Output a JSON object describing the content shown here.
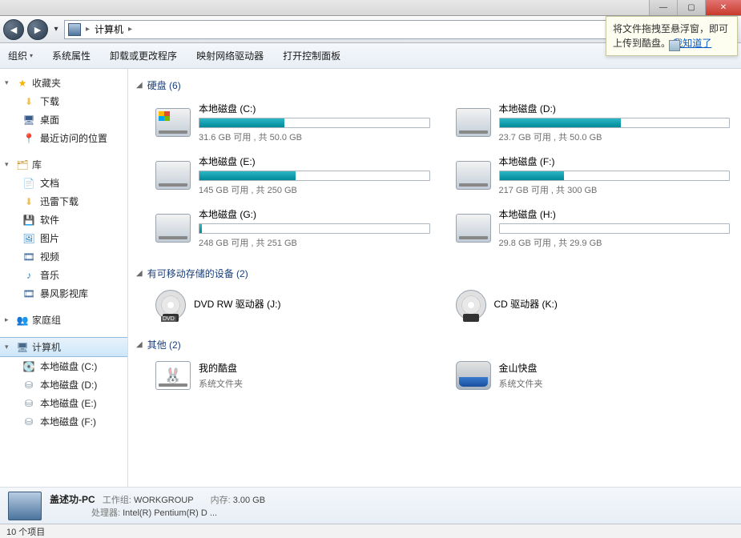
{
  "titlebar": {
    "min": "—",
    "max": "▢",
    "close": "✕"
  },
  "nav": {
    "back": "◄",
    "forward": "►",
    "dd": "▾",
    "path_label": "计算机",
    "arrow": "▸",
    "refresh": "↻",
    "addr_dd": "▾"
  },
  "toolbar": {
    "organize": "组织",
    "dd": "▾",
    "sysprops": "系统属性",
    "uninstall": "卸载或更改程序",
    "mapdrive": "映射网络驱动器",
    "controlpanel": "打开控制面板"
  },
  "sidebar": {
    "fav": {
      "label": "收藏夹",
      "items": [
        {
          "label": "下载"
        },
        {
          "label": "桌面"
        },
        {
          "label": "最近访问的位置"
        }
      ]
    },
    "lib": {
      "label": "库",
      "items": [
        {
          "label": "文档"
        },
        {
          "label": "迅雷下载"
        },
        {
          "label": "软件"
        },
        {
          "label": "图片"
        },
        {
          "label": "视频"
        },
        {
          "label": "音乐"
        },
        {
          "label": "暴风影视库"
        }
      ]
    },
    "homegroup": {
      "label": "家庭组"
    },
    "computer": {
      "label": "计算机",
      "items": [
        {
          "label": "本地磁盘 (C:)"
        },
        {
          "label": "本地磁盘 (D:)"
        },
        {
          "label": "本地磁盘 (E:)"
        },
        {
          "label": "本地磁盘 (F:)"
        }
      ]
    }
  },
  "sections": {
    "hdd": {
      "title": "硬盘 (6)"
    },
    "removable": {
      "title": "有可移动存储的设备 (2)"
    },
    "other": {
      "title": "其他 (2)"
    }
  },
  "drives": [
    {
      "label": "本地磁盘 (C:)",
      "stats": "31.6 GB 可用 , 共 50.0 GB",
      "pct": 37,
      "win": true
    },
    {
      "label": "本地磁盘 (D:)",
      "stats": "23.7 GB 可用 , 共 50.0 GB",
      "pct": 53
    },
    {
      "label": "本地磁盘 (E:)",
      "stats": "145 GB 可用 , 共 250 GB",
      "pct": 42
    },
    {
      "label": "本地磁盘 (F:)",
      "stats": "217 GB 可用 , 共 300 GB",
      "pct": 28
    },
    {
      "label": "本地磁盘 (G:)",
      "stats": "248 GB 可用 , 共 251 GB",
      "pct": 1
    },
    {
      "label": "本地磁盘 (H:)",
      "stats": "29.8 GB 可用 , 共 29.9 GB",
      "pct": 0
    }
  ],
  "removable": [
    {
      "label": "DVD RW 驱动器 (J:)",
      "type": "dvd",
      "dvdmark": true
    },
    {
      "label": "CD 驱动器 (K:)",
      "type": "dvd"
    }
  ],
  "other": [
    {
      "label": "我的酷盘",
      "sub": "系统文件夹",
      "icon": "kanbox"
    },
    {
      "label": "金山快盘",
      "sub": "系统文件夹",
      "icon": "kuaipan"
    }
  ],
  "details": {
    "name": "盖述功-PC",
    "workgroup_k": "工作组:",
    "workgroup_v": "WORKGROUP",
    "mem_k": "内存:",
    "mem_v": "3.00 GB",
    "cpu_k": "处理器:",
    "cpu_v": "Intel(R) Pentium(R) D ..."
  },
  "status": "10 个项目",
  "popover": {
    "text": "将文件拖拽至悬浮窗，即可上传到酷盘。",
    "link": "我知道了"
  }
}
